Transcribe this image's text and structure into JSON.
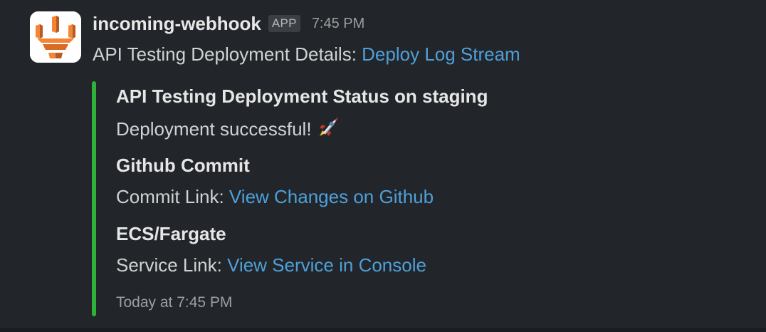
{
  "message": {
    "sender": "incoming-webhook",
    "badge": "APP",
    "timestamp": "7:45 PM",
    "text_prefix": "API Testing Deployment Details: ",
    "link_label": "Deploy Log Stream"
  },
  "attachment": {
    "accent_color": "#2eb039",
    "title": "API Testing Deployment Status on staging",
    "text": "Deployment successful!",
    "emoji": "rocket-icon",
    "fields": [
      {
        "title": "Github Commit",
        "value_prefix": "Commit Link: ",
        "link_label": "View Changes on Github"
      },
      {
        "title": "ECS/Fargate",
        "value_prefix": "Service Link: ",
        "link_label": "View Service in Console"
      }
    ],
    "footer": "Today at 7:45 PM"
  },
  "colors": {
    "background": "#222529",
    "link": "#4ea0d9",
    "avatar_orange": "#f58535"
  }
}
